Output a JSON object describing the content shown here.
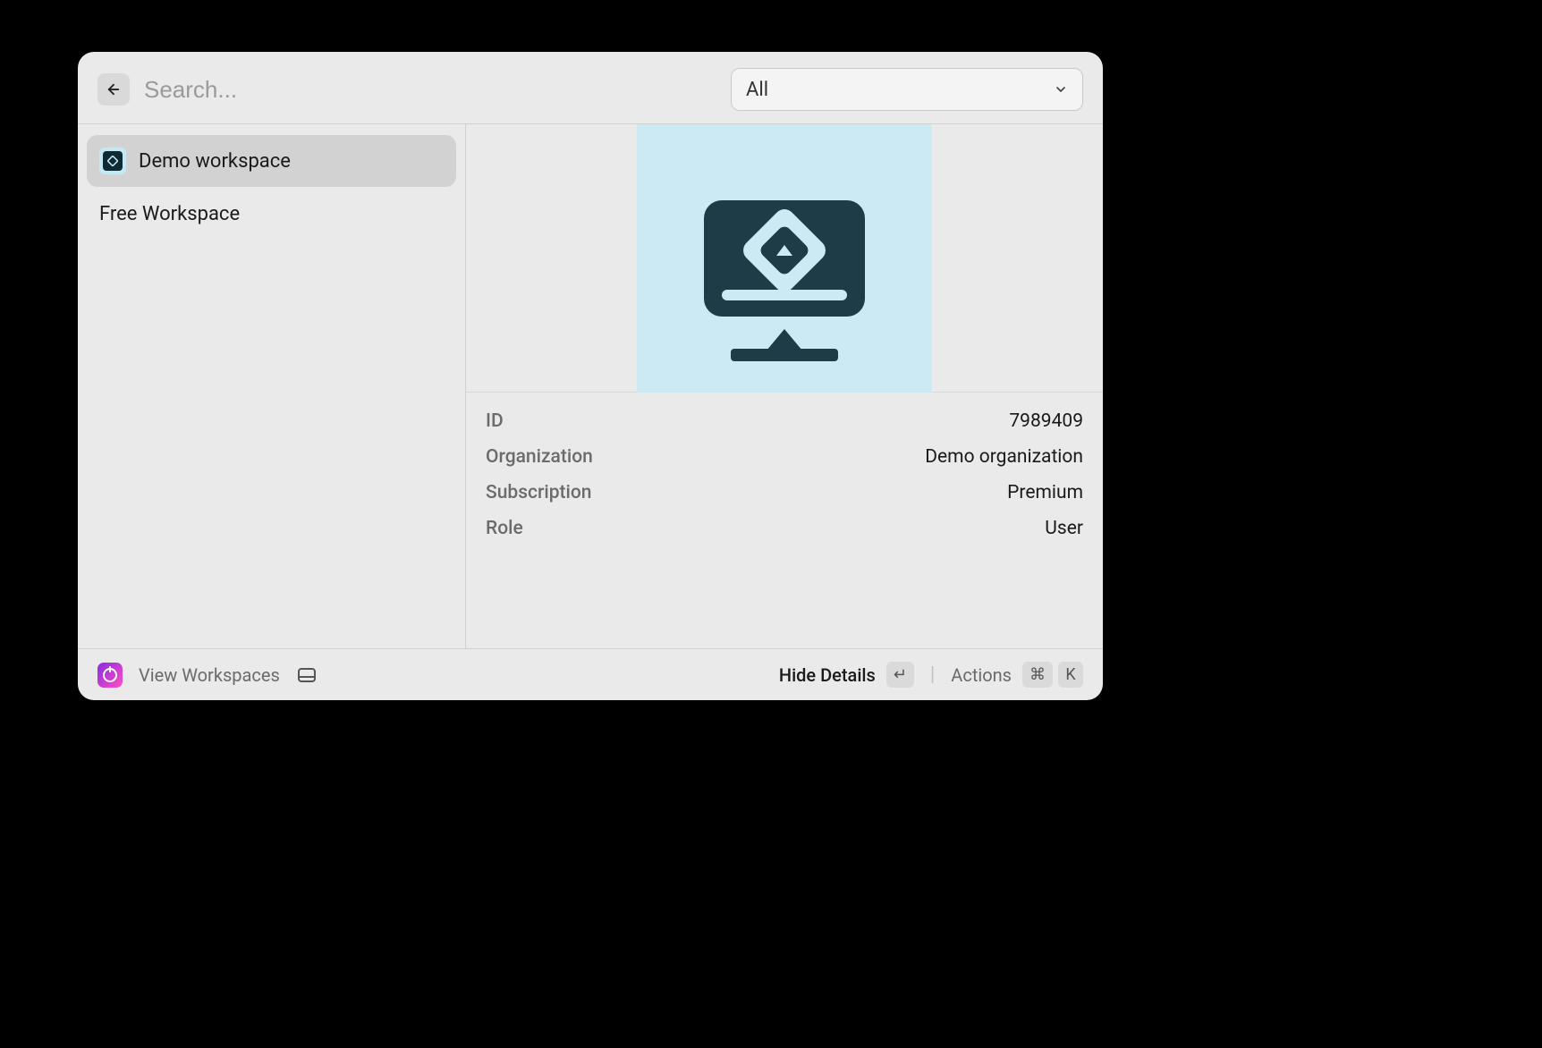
{
  "header": {
    "search_placeholder": "Search...",
    "filter_selected": "All"
  },
  "sidebar": {
    "items": [
      {
        "label": "Demo workspace",
        "selected": true,
        "has_icon": true
      },
      {
        "label": "Free Workspace",
        "selected": false,
        "has_icon": false
      }
    ]
  },
  "detail": {
    "meta": [
      {
        "label": "ID",
        "value": "7989409"
      },
      {
        "label": "Organization",
        "value": "Demo organization"
      },
      {
        "label": "Subscription",
        "value": "Premium"
      },
      {
        "label": "Role",
        "value": "User"
      }
    ]
  },
  "footer": {
    "view_label": "View Workspaces",
    "hide_details_label": "Hide Details",
    "actions_label": "Actions",
    "enter_key": "↵",
    "cmd_key": "⌘",
    "k_key": "K"
  }
}
